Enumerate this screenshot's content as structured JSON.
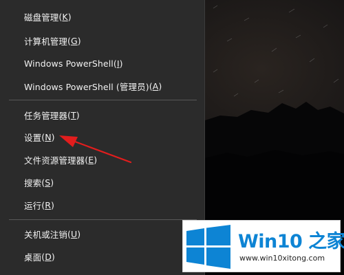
{
  "menu": {
    "items": [
      {
        "label": "磁盘管理",
        "key": "K"
      },
      {
        "label": "计算机管理",
        "key": "G"
      },
      {
        "label": "Windows PowerShell",
        "key": "I"
      },
      {
        "label": "Windows PowerShell (管理员)",
        "key": "A"
      },
      {
        "label": "任务管理器",
        "key": "T"
      },
      {
        "label": "设置",
        "key": "N"
      },
      {
        "label": "文件资源管理器",
        "key": "E"
      },
      {
        "label": "搜索",
        "key": "S"
      },
      {
        "label": "运行",
        "key": "R"
      },
      {
        "label": "关机或注销",
        "key": "U"
      },
      {
        "label": "桌面",
        "key": "D"
      }
    ]
  },
  "annotation": {
    "color": "#e21d1d"
  },
  "watermark": {
    "brand": "Win10 之家",
    "site": "www.win10xitong.com",
    "icon": "windows-logo-icon",
    "color": "#0d84d4"
  }
}
